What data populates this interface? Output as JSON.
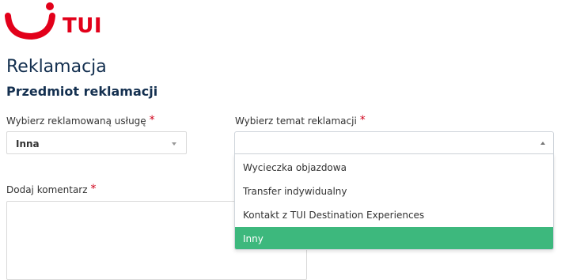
{
  "brand": {
    "name": "TUI",
    "color": "#e2001a"
  },
  "page": {
    "title": "Reklamacja",
    "subtitle": "Przedmiot reklamacji"
  },
  "service_field": {
    "label": "Wybierz reklamowaną usługę",
    "required_mark": "*",
    "value": "Inna"
  },
  "topic_field": {
    "label": "Wybierz temat reklamacji",
    "required_mark": "*",
    "value": "",
    "options": [
      "Wycieczka objazdowa",
      "Transfer indywidualny",
      "Kontakt z TUI Destination Experiences",
      "Inny"
    ],
    "highlighted_option": "Inny",
    "highlight_color": "#3db87d"
  },
  "comment_field": {
    "label": "Dodaj komentarz",
    "required_mark": "*",
    "value": ""
  }
}
